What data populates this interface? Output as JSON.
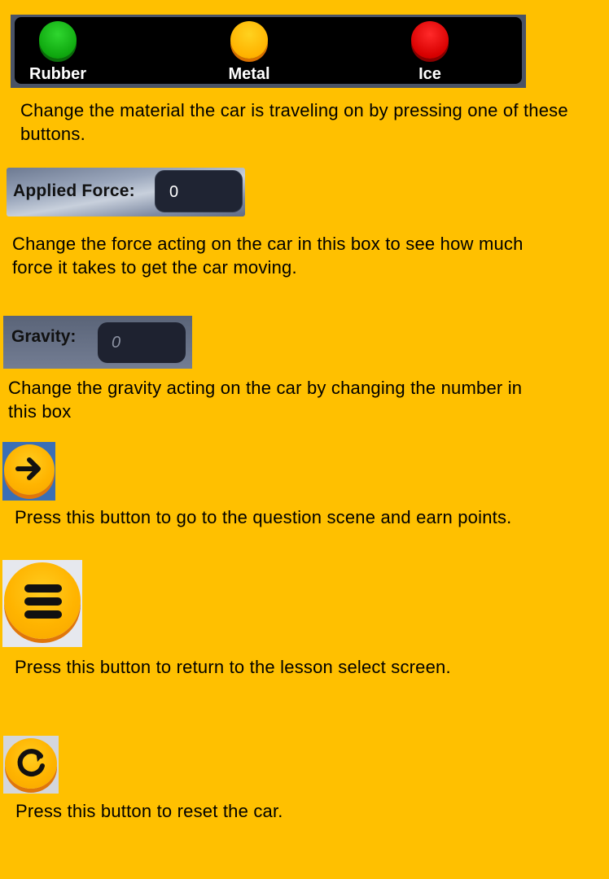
{
  "materials": {
    "buttons": [
      {
        "label": "Rubber",
        "color": "#12b112"
      },
      {
        "label": "Metal",
        "color": "#ffb300"
      },
      {
        "label": "Ice",
        "color": "#dd0a0a"
      }
    ],
    "description": "Change the material the car is traveling on by pressing one of these buttons."
  },
  "applied_force": {
    "label": "Applied Force:",
    "value": "0",
    "description": "Change the force acting on the car in this box to see how much force it takes to get the car moving."
  },
  "gravity": {
    "label": "Gravity:",
    "placeholder": "0",
    "description": "Change the gravity acting on the car by changing the number in this box"
  },
  "next_button": {
    "icon": "arrow-right-icon",
    "description": "Press this button to go to the question scene and earn points."
  },
  "menu_button": {
    "icon": "menu-icon",
    "description": "Press this button to return to the lesson select screen."
  },
  "reset_button": {
    "icon": "refresh-icon",
    "description": "Press this button to reset the car."
  }
}
